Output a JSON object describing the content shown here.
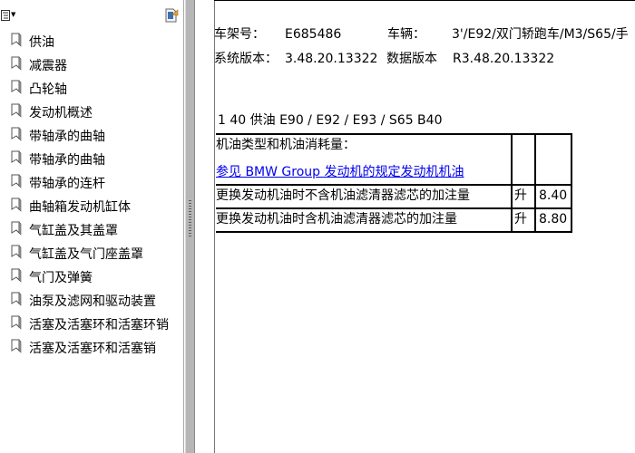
{
  "sidebar": {
    "items": [
      {
        "label": "供油"
      },
      {
        "label": "减震器"
      },
      {
        "label": "凸轮轴"
      },
      {
        "label": "发动机概述"
      },
      {
        "label": "带轴承的曲轴"
      },
      {
        "label": "带轴承的曲轴"
      },
      {
        "label": "带轴承的连杆"
      },
      {
        "label": "曲轴箱发动机缸体"
      },
      {
        "label": "气缸盖及其盖罩"
      },
      {
        "label": "气缸盖及气门座盖罩"
      },
      {
        "label": "气门及弹簧"
      },
      {
        "label": "油泵及滤网和驱动装置"
      },
      {
        "label": "活塞及活塞环和活塞环销"
      },
      {
        "label": "活塞及活塞环和活塞销"
      }
    ]
  },
  "doc": {
    "chassis_label": "车架号：",
    "chassis_value": "E685486",
    "vehicle_label": "车辆：",
    "vehicle_value": "3'/E92/双门轿跑车/M3/S65/手",
    "system_version_label": "系统版本：",
    "system_version_value": "3.48.20.13322",
    "data_version_label": "数据版本",
    "data_version_value": "R3.48.20.13322",
    "section_heading": "1 40 供油 E90 / E92 / E93 / S65 B40",
    "table": {
      "row1_line1": "机油类型和机油消耗量：",
      "row1_link": "参见 BMW Group 发动机的规定发动机机油",
      "rows": [
        {
          "desc": "更换发动机油时不含机油滤清器滤芯的加注量",
          "unit": "升",
          "value": "8.40"
        },
        {
          "desc": "更换发动机油时含机油滤清器滤芯的加注量",
          "unit": "升",
          "value": "8.80"
        }
      ]
    }
  }
}
